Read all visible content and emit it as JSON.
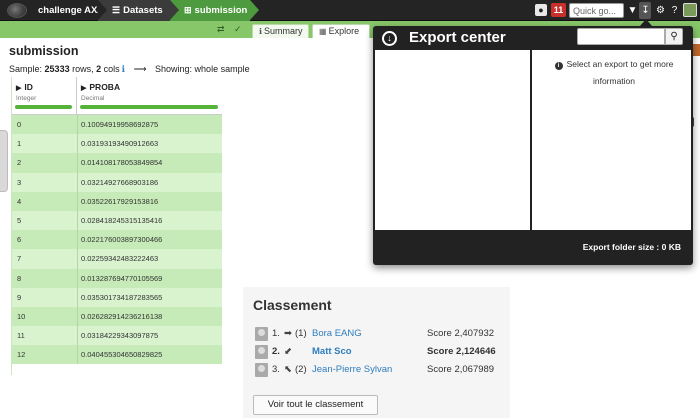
{
  "topbar": {
    "project": "challenge AXA",
    "datasets": "Datasets",
    "dataset": "submission",
    "notification_count": "11",
    "quick_search_placeholder": "Quick go..."
  },
  "tabs": [
    {
      "label": "Summary"
    },
    {
      "label": "Explore"
    }
  ],
  "page": {
    "title": "submission",
    "sample_prefix": "Sample:",
    "sample_rows": "25333",
    "sample_rows_suffix": "rows,",
    "sample_cols": "2",
    "sample_cols_suffix": "cols",
    "showing": "Showing: whole sample"
  },
  "table": {
    "columns": [
      {
        "name": "ID",
        "type": "Integer"
      },
      {
        "name": "PROBA",
        "type": "Decimal"
      }
    ],
    "rows": [
      [
        "0",
        "0.10094919958692875"
      ],
      [
        "1",
        "0.03193193490912663"
      ],
      [
        "2",
        "0.014108178053849854"
      ],
      [
        "3",
        "0.03214927668903186"
      ],
      [
        "4",
        "0.03522617929153816"
      ],
      [
        "5",
        "0.028418245315135416"
      ],
      [
        "6",
        "0.022176003897300466"
      ],
      [
        "7",
        "0.02259342483222463"
      ],
      [
        "8",
        "0.013287694770105569"
      ],
      [
        "9",
        "0.035301734187283565"
      ],
      [
        "10",
        "0.026282914236216138"
      ],
      [
        "11",
        "0.03184229343097875"
      ],
      [
        "12",
        "0.040455304650829825"
      ]
    ]
  },
  "export_center": {
    "title": "Export center",
    "info": "Select an export to get more information",
    "footer": "Export folder size : 0 KB"
  },
  "leaderboard": {
    "title": "Classement",
    "entries": [
      {
        "rank": "1.",
        "move": "➡",
        "prev": "(1)",
        "name": "Bora EANG",
        "score": "Score 2,407932"
      },
      {
        "rank": "2.",
        "move": "⬋",
        "prev": "",
        "name": "Matt Sco",
        "score": "Score 2,124646"
      },
      {
        "rank": "3.",
        "move": "⬉",
        "prev": "(2)",
        "name": "Jean-Pierre Sylvan",
        "score": "Score 2,067989"
      }
    ],
    "button": "Voir tout le classement"
  },
  "colors": {
    "topbar": "#242424",
    "green": "#4e9a3e",
    "light_green": "#87c76a",
    "badge_red": "#c9302c",
    "link_blue": "#2f7dbd"
  }
}
